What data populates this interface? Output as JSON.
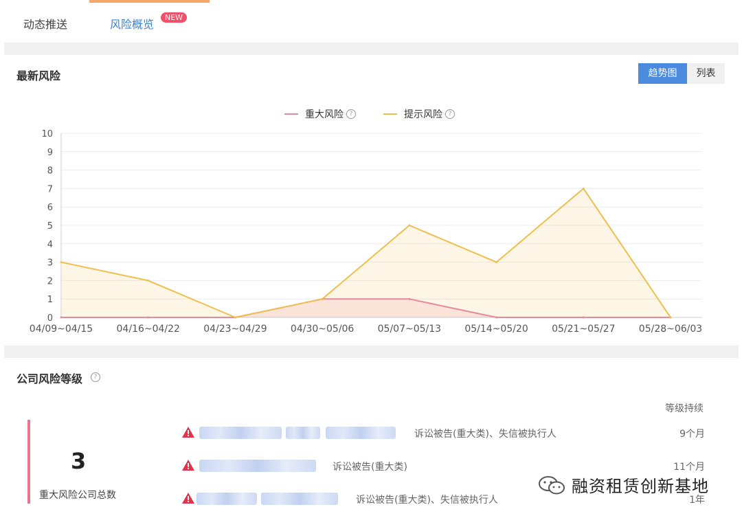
{
  "tabs": [
    {
      "label": "动态推送"
    },
    {
      "label": "风险概览",
      "badge": "NEW"
    }
  ],
  "latest_risk": {
    "title": "最新风险",
    "toggle": {
      "trend": "趋势图",
      "list": "列表",
      "active": "趋势图"
    }
  },
  "legend": [
    {
      "name": "重大风险",
      "color": "#e8899a",
      "help_icon": "help-icon"
    },
    {
      "name": "提示风险",
      "color": "#efbf4e",
      "help_icon": "help-icon"
    }
  ],
  "chart_data": {
    "type": "area",
    "x": [
      "04/09~04/15",
      "04/16~04/22",
      "04/23~04/29",
      "04/30~05/06",
      "05/07~05/13",
      "05/14~05/20",
      "05/21~05/27",
      "05/28~06/03"
    ],
    "series": [
      {
        "name": "重大风险",
        "color": "#e8899a",
        "values": [
          0,
          0,
          0,
          1,
          1,
          0,
          0,
          0
        ]
      },
      {
        "name": "提示风险",
        "color": "#efbf4e",
        "values": [
          3,
          2,
          0,
          1,
          5,
          3,
          7,
          0
        ]
      }
    ],
    "yticks": [
      0,
      1,
      2,
      3,
      4,
      5,
      6,
      7,
      8,
      9,
      10
    ],
    "ylim": [
      0,
      10
    ],
    "grid": true,
    "legend_position": "top-center"
  },
  "company_level": {
    "title": "公司风险等级",
    "duration_header": "等级持续",
    "count": "3",
    "count_label": "重大风险公司总数",
    "rows": [
      {
        "icon": "warning-icon",
        "types": "诉讼被告(重大类)、失信被执行人",
        "duration": "9个月"
      },
      {
        "icon": "warning-icon",
        "types": "诉讼被告(重大类)",
        "duration": "11个月"
      },
      {
        "icon": "warning-icon",
        "types": "诉讼被告(重大类)、失信被执行人",
        "duration": "1年"
      }
    ]
  },
  "watermark": {
    "text": "融资租赁创新基地",
    "icon": "wechat-icon"
  }
}
